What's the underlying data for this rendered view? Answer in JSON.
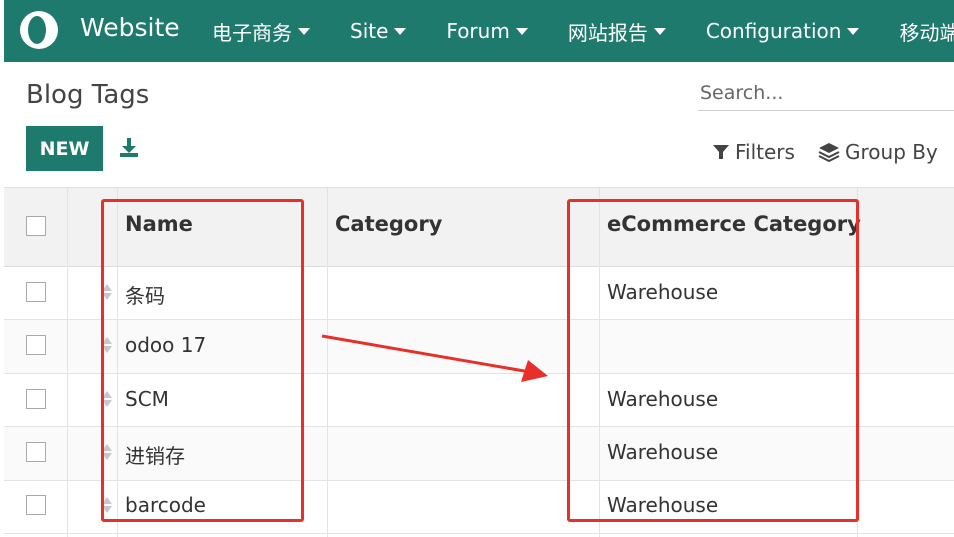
{
  "navbar": {
    "brand": "Website",
    "menu": [
      {
        "label": "电子商务"
      },
      {
        "label": "Site"
      },
      {
        "label": "Forum"
      },
      {
        "label": "网站报告"
      },
      {
        "label": "Configuration"
      },
      {
        "label": "移动端配"
      }
    ]
  },
  "control_panel": {
    "title": "Blog Tags",
    "new_label": "NEW",
    "search_placeholder": "Search...",
    "filters_label": "Filters",
    "groupby_label": "Group By"
  },
  "table": {
    "columns": [
      "Name",
      "Category",
      "eCommerce Category"
    ],
    "rows": [
      {
        "name": "条码",
        "category": "",
        "ecommerce_category": "Warehouse"
      },
      {
        "name": "odoo 17",
        "category": "",
        "ecommerce_category": ""
      },
      {
        "name": "SCM",
        "category": "",
        "ecommerce_category": "Warehouse"
      },
      {
        "name": "进销存",
        "category": "",
        "ecommerce_category": "Warehouse"
      },
      {
        "name": "barcode",
        "category": "",
        "ecommerce_category": "Warehouse"
      }
    ]
  },
  "colors": {
    "brand": "#1f7a6e",
    "annotation": "#e8302a"
  }
}
